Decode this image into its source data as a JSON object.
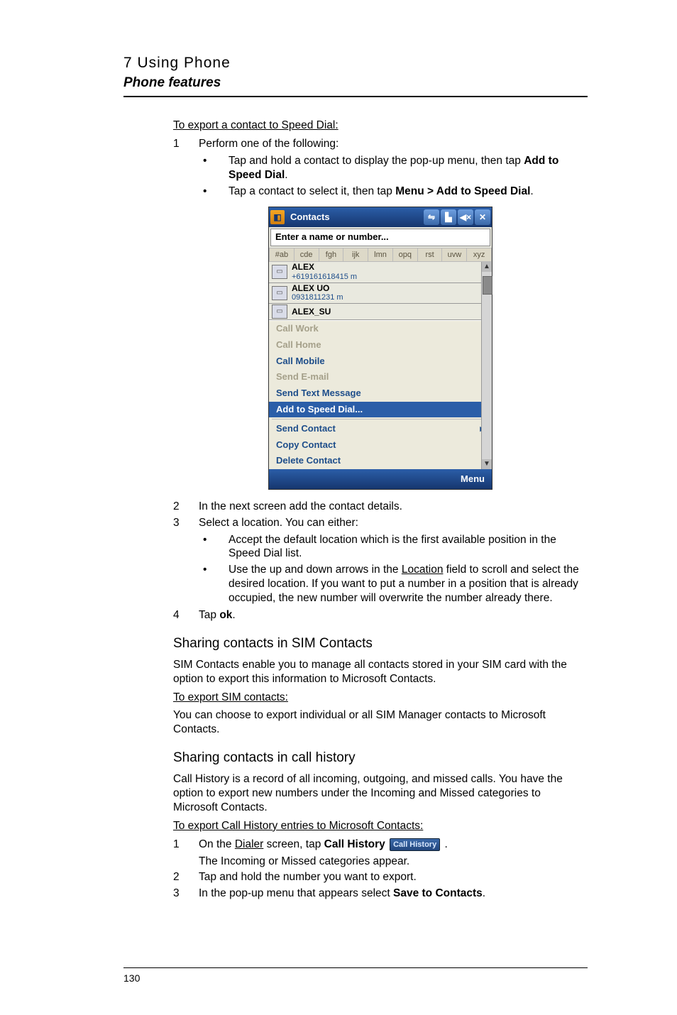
{
  "chapter": {
    "num": "7 Using Phone",
    "sub": "Phone features"
  },
  "body": {
    "export_sd_title": "To export a contact to Speed Dial:",
    "step1_num": "1",
    "step1_txt": "Perform one of the following:",
    "step1_b1a": "Tap and hold a contact to display the pop-up menu, then tap ",
    "step1_b1b": "Add to Speed Dial",
    "step1_b1c": ".",
    "step1_b2a": "Tap a contact to select it, then tap ",
    "step1_b2b": "Menu > Add to Speed Dial",
    "step1_b2c": ".",
    "step2_num": "2",
    "step2_txt": "In the next screen add the contact details.",
    "step3_num": "3",
    "step3_txt": "Select a location. You can either:",
    "step3_b1": "Accept the default location which is the first available position in the Speed Dial list.",
    "step3_b2a": "Use the up and down arrows in the ",
    "step3_b2b": "Location",
    "step3_b2c": " field to scroll and select the desired location. If you want to put a number in a position that is already occupied, the new number will overwrite the number already there.",
    "step4_num": "4",
    "step4_txt_a": "Tap ",
    "step4_txt_b": "ok",
    "step4_txt_c": ".",
    "sim_h": "Sharing contacts in SIM Contacts",
    "sim_p": "SIM Contacts enable you to manage all contacts stored in your SIM card with the option to export this information to Microsoft Contacts.",
    "sim_sub": "To export SIM contacts:",
    "sim_p2": "You can choose to export individual or all SIM Manager contacts to Microsoft Contacts.",
    "hist_h": "Sharing contacts in call history",
    "hist_p": "Call History is a record of all incoming, outgoing, and missed calls. You have the option to export new numbers under the Incoming and Missed categories to Microsoft Contacts.",
    "hist_sub": "To export Call History entries to Microsoft Contacts:",
    "hist1_num": "1",
    "hist1_a": "On the ",
    "hist1_b": "Dialer",
    "hist1_c": " screen, tap ",
    "hist1_d": "Call History",
    "hist1_badge": "Call History",
    "hist1_e": " .",
    "hist1_line2": "The Incoming or Missed categories appear.",
    "hist2_num": "2",
    "hist2_txt": "Tap and hold the number you want to export.",
    "hist3_num": "3",
    "hist3_a": "In the pop-up menu that appears select ",
    "hist3_b": "Save to Contacts",
    "hist3_c": "."
  },
  "shot": {
    "title": "Contacts",
    "enter": "Enter a name or number...",
    "alpha": [
      "#ab",
      "cde",
      "fgh",
      "ijk",
      "lmn",
      "opq",
      "rst",
      "uvw",
      "xyz"
    ],
    "rows": [
      {
        "name": "ALEX",
        "sub": "+619161618415  m"
      },
      {
        "name": "ALEX UO",
        "sub": "0931811231  m"
      },
      {
        "name": "ALEX_SU",
        "sub": ""
      }
    ],
    "menu": {
      "m1": "Call Work",
      "m2": "Call Home",
      "m3": "Call Mobile",
      "m4": "Send E-mail",
      "m5": "Send Text Message",
      "m6": "Add to Speed Dial...",
      "m7": "Send Contact",
      "m8": "Copy Contact",
      "m9": "Delete Contact"
    },
    "menubtn": "Menu"
  },
  "pagenum": "130"
}
